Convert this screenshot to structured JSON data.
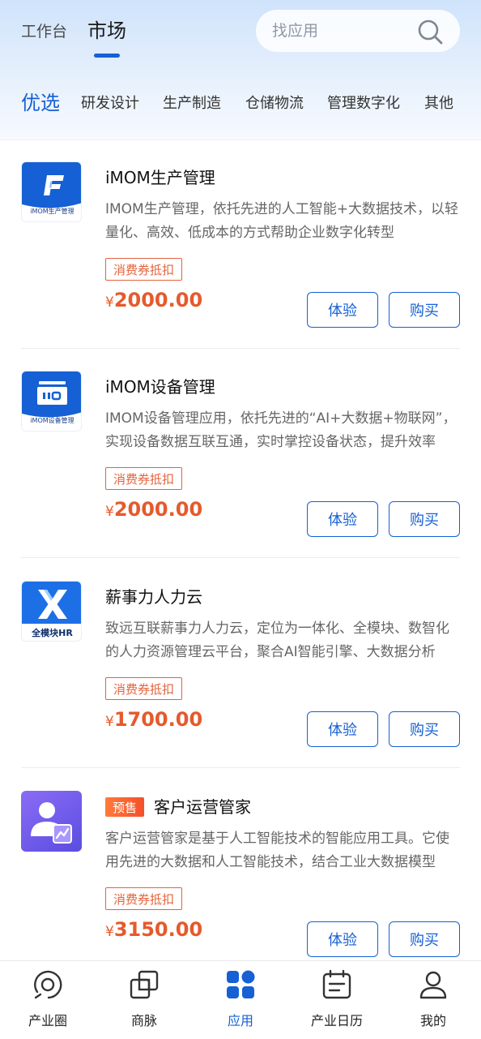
{
  "header": {
    "tabs": [
      {
        "label": "工作台",
        "active": false
      },
      {
        "label": "市场",
        "active": true
      }
    ],
    "search": {
      "placeholder": "找应用",
      "icon": "search-icon"
    }
  },
  "categories": [
    {
      "label": "优选",
      "active": true
    },
    {
      "label": "研发设计"
    },
    {
      "label": "生产制造"
    },
    {
      "label": "仓储物流"
    },
    {
      "label": "管理数字化"
    },
    {
      "label": "其他"
    }
  ],
  "apps": [
    {
      "name": "iMOM生产管理",
      "icon_caption": "iMOM生产管理",
      "description": "IMOM生产管理，依托先进的人工智能+大数据技术，以轻量化、高效、低成本的方式帮助企业数字化转型",
      "coupon": "消费券抵扣",
      "currency": "¥",
      "price": "2000.00",
      "try_label": "体验",
      "buy_label": "购买"
    },
    {
      "name": "iMOM设备管理",
      "icon_caption": "iMOM设备管理",
      "description": "IMOM设备管理应用，依托先进的“AI+大数据+物联网”，实现设备数据互联互通，实时掌控设备状态，提升效率",
      "coupon": "消费券抵扣",
      "currency": "¥",
      "price": "2000.00",
      "try_label": "体验",
      "buy_label": "购买"
    },
    {
      "name": "薪事力人力云",
      "icon_caption": "全模块HR",
      "description": "致远互联薪事力人力云，定位为一体化、全模块、数智化的人力资源管理云平台，聚合AI智能引擎、大数据分析",
      "coupon": "消费券抵扣",
      "currency": "¥",
      "price": "1700.00",
      "try_label": "体验",
      "buy_label": "购买"
    },
    {
      "name": "客户运营管家",
      "badge": "预售",
      "description": "客户运营管家是基于人工智能技术的智能应用工具。它使用先进的大数据和人工智能技术，结合工业大数据模型",
      "coupon": "消费券抵扣",
      "currency": "¥",
      "price": "3150.00",
      "try_label": "体验",
      "buy_label": "购买"
    }
  ],
  "bottom_nav": [
    {
      "label": "产业圈",
      "icon": "industry-circle-icon"
    },
    {
      "label": "商脉",
      "icon": "business-network-icon"
    },
    {
      "label": "应用",
      "icon": "apps-grid-icon",
      "active": true
    },
    {
      "label": "产业日历",
      "icon": "calendar-icon"
    },
    {
      "label": "我的",
      "icon": "user-icon"
    }
  ],
  "colors": {
    "accent": "#1560d4",
    "price": "#e55a2c",
    "coupon": "#e5623b"
  }
}
